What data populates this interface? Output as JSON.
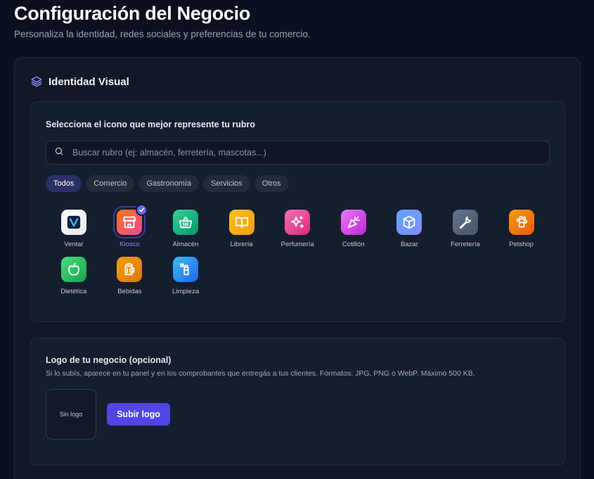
{
  "header": {
    "title": "Configuración del Negocio",
    "subtitle": "Personaliza la identidad, redes sociales y preferencias de tu comercio."
  },
  "identity": {
    "section_title": "Identidad Visual",
    "section_icon": "layers-icon",
    "picker": {
      "heading": "Selecciona el icono que mejor represente tu rubro",
      "search_placeholder": "Buscar rubro (ej: almacén, ferretería, mascotas...)",
      "filters": [
        {
          "label": "Todos",
          "active": true
        },
        {
          "label": "Comercio",
          "active": false
        },
        {
          "label": "Gastronomía",
          "active": false
        },
        {
          "label": "Servicios",
          "active": false
        },
        {
          "label": "Otros",
          "active": false
        }
      ],
      "selected": "Kiosco",
      "icons": [
        {
          "label": "Ventar",
          "icon": "ventar-logo-icon",
          "colors": [
            "#ffffff",
            "#e5e7eb"
          ]
        },
        {
          "label": "Kiosco",
          "icon": "store-icon",
          "colors": [
            "#f97316",
            "#ec4899"
          ]
        },
        {
          "label": "Almacén",
          "icon": "basket-icon",
          "colors": [
            "#34d399",
            "#059669"
          ]
        },
        {
          "label": "Librería",
          "icon": "book-icon",
          "colors": [
            "#fbbf24",
            "#f59e0b"
          ]
        },
        {
          "label": "Perfumería",
          "icon": "sparkles-icon",
          "colors": [
            "#f472b6",
            "#db2777"
          ]
        },
        {
          "label": "Cotillón",
          "icon": "party-popper-icon",
          "colors": [
            "#e879f9",
            "#c026d3"
          ]
        },
        {
          "label": "Bazar",
          "icon": "box-icon",
          "colors": [
            "#60a5fa",
            "#818cf8"
          ]
        },
        {
          "label": "Ferretería",
          "icon": "wrench-icon",
          "colors": [
            "#64748b",
            "#475569"
          ]
        },
        {
          "label": "Petshop",
          "icon": "paw-icon",
          "colors": [
            "#f59e0b",
            "#ea580c"
          ]
        },
        {
          "label": "Dietética",
          "icon": "apple-icon",
          "colors": [
            "#4ade80",
            "#16a34a"
          ]
        },
        {
          "label": "Bebidas",
          "icon": "beer-icon",
          "colors": [
            "#f59e0b",
            "#d97706"
          ]
        },
        {
          "label": "Limpieza",
          "icon": "spray-bottle-icon",
          "colors": [
            "#38bdf8",
            "#2563eb"
          ]
        }
      ]
    },
    "logo": {
      "heading": "Logo de tu negocio (opcional)",
      "help": "Si lo subís, aparece en tu panel y en los comprobantes que entregás a tus clientes. Formatos: JPG, PNG o WebP. Máximo 500 KB.",
      "empty_label": "Sin logo",
      "upload_label": "Subir logo"
    }
  },
  "colors": {
    "accent": "#4f46e5",
    "selected_label": "#818cf8",
    "background": "#0b1020",
    "card": "#111827"
  }
}
